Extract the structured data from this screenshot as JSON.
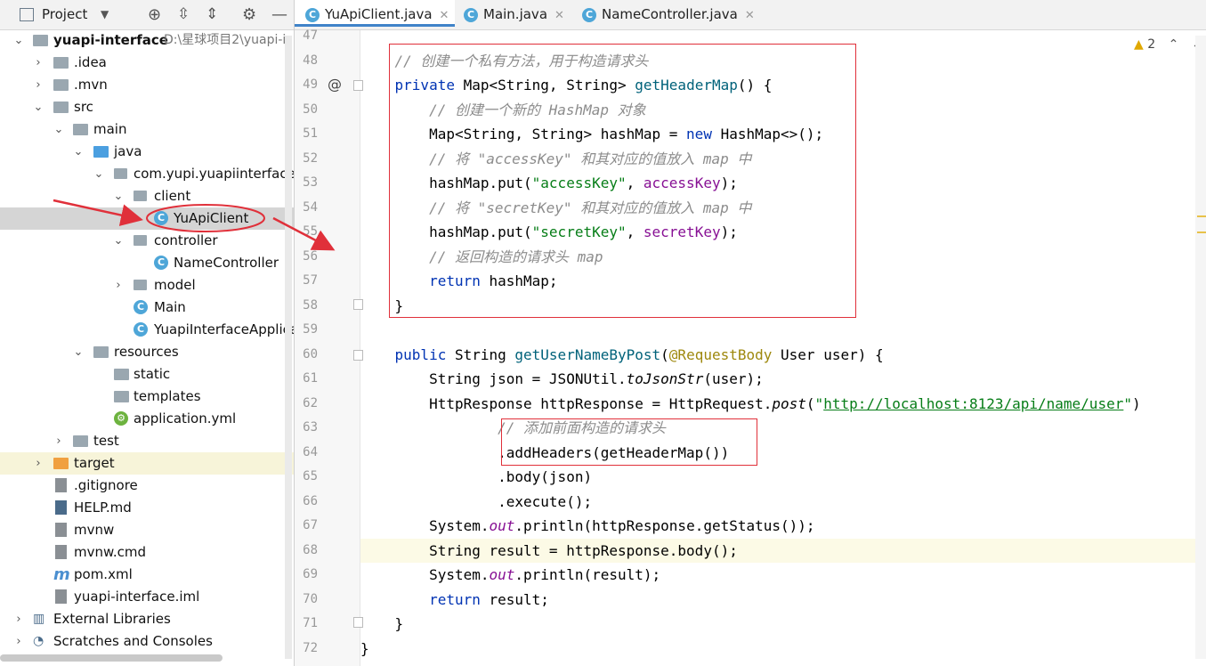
{
  "project": {
    "title": "Project",
    "rows": [
      {
        "label": "yuapi-interface",
        "path": "D:\\星球项目2\\yuapi-i"
      },
      {
        "label": ".idea"
      },
      {
        "label": ".mvn"
      },
      {
        "label": "src"
      },
      {
        "label": "main"
      },
      {
        "label": "java"
      },
      {
        "label": "com.yupi.yuapiinterface"
      },
      {
        "label": "client"
      },
      {
        "label": "YuApiClient"
      },
      {
        "label": "controller"
      },
      {
        "label": "NameController"
      },
      {
        "label": "model"
      },
      {
        "label": "Main"
      },
      {
        "label": "YuapiInterfaceApplica"
      },
      {
        "label": "resources"
      },
      {
        "label": "static"
      },
      {
        "label": "templates"
      },
      {
        "label": "application.yml"
      },
      {
        "label": "test"
      },
      {
        "label": "target"
      },
      {
        "label": ".gitignore"
      },
      {
        "label": "HELP.md"
      },
      {
        "label": "mvnw"
      },
      {
        "label": "mvnw.cmd"
      },
      {
        "label": "pom.xml"
      },
      {
        "label": "yuapi-interface.iml"
      },
      {
        "label": "External Libraries"
      },
      {
        "label": "Scratches and Consoles"
      }
    ]
  },
  "tabs": [
    {
      "label": "YuApiClient.java"
    },
    {
      "label": "Main.java"
    },
    {
      "label": "NameController.java"
    }
  ],
  "inspection": {
    "count": "2"
  },
  "gutter_mark": "@",
  "lines": [
    "47",
    "48",
    "49",
    "50",
    "51",
    "52",
    "53",
    "54",
    "55",
    "56",
    "57",
    "58",
    "59",
    "60",
    "61",
    "62",
    "63",
    "64",
    "65",
    "66",
    "67",
    "68",
    "69",
    "70",
    "71",
    "72"
  ],
  "code": {
    "c48": "// 创建一个私有方法，用于构造请求头",
    "c50": "// 创建一个新的 HashMap 对象",
    "c52": "// 将 \"accessKey\" 和其对应的值放入 map 中",
    "c54": "// 将 \"secretKey\" 和其对应的值放入 map 中",
    "c56": "// 返回构造的请求头 map",
    "c63": "// 添加前面构造的请求头",
    "url": "http://localhost:8123/api/name/user",
    "s_access": "\"accessKey\"",
    "s_secret": "\"secretKey\"",
    "f_access": "accessKey",
    "f_secret": "secretKey"
  },
  "colors": {
    "accent": "#4083c9",
    "highlight_box": "#e0303a",
    "arrow": "#e0303a"
  }
}
